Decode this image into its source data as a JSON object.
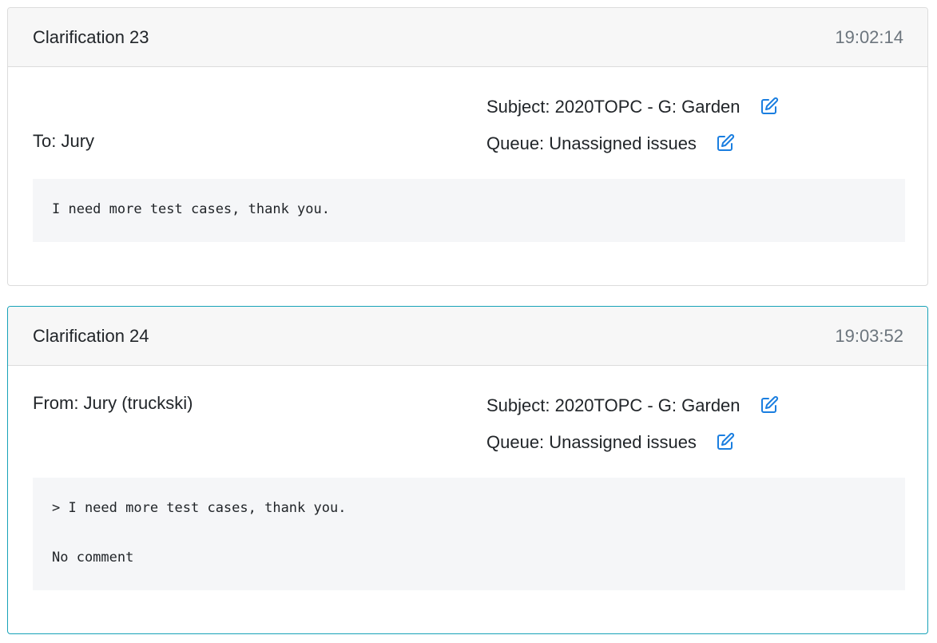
{
  "clarifications": [
    {
      "title": "Clarification 23",
      "time": "19:02:14",
      "party": "To: Jury",
      "subject": "Subject: 2020TOPC - G: Garden",
      "queue": "Queue: Unassigned issues",
      "message_lines": [
        "I need more test cases, thank you."
      ]
    },
    {
      "title": "Clarification 24",
      "time": "19:03:52",
      "party": "From: Jury (truckski)",
      "subject": "Subject: 2020TOPC - G: Garden",
      "queue": "Queue: Unassigned issues",
      "message_lines": [
        "> I need more test cases, thank you.",
        "No comment"
      ]
    }
  ],
  "colors": {
    "edit_icon": "#1a7ee0",
    "highlight_border": "#17a2b8"
  },
  "icons": {
    "subject_edit": "edit-icon",
    "queue_edit": "edit-icon"
  }
}
